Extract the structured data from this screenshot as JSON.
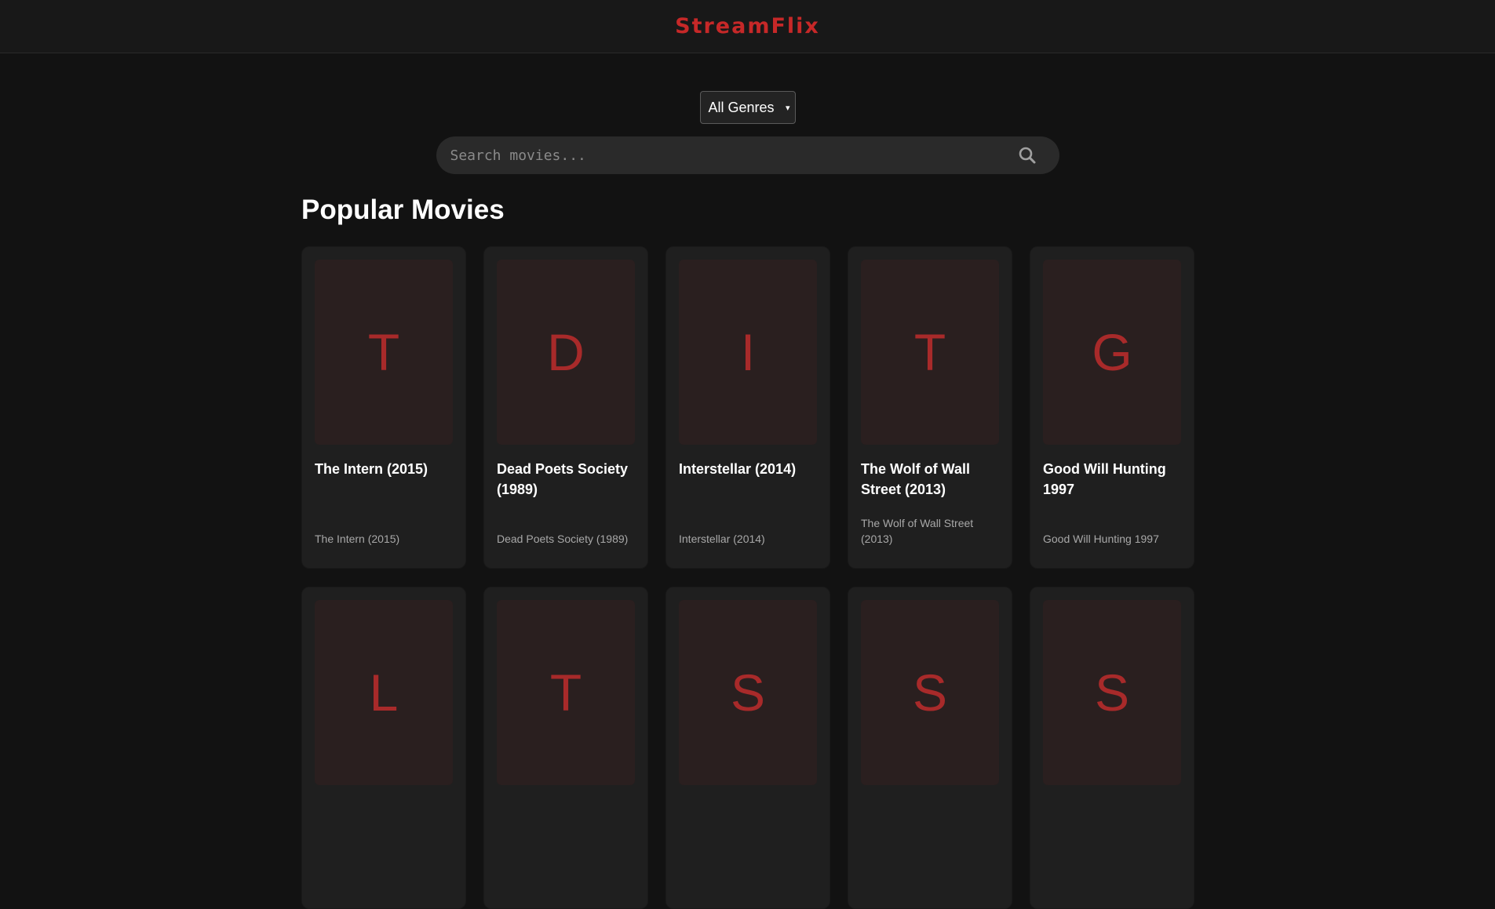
{
  "header": {
    "logo": "StreamFlix"
  },
  "filters": {
    "genre_selected": "All Genres"
  },
  "search": {
    "placeholder": "Search movies..."
  },
  "section": {
    "title": "Popular Movies"
  },
  "movies": [
    {
      "initial": "T",
      "title": "The Intern (2015)",
      "subtitle": "The Intern (2015)"
    },
    {
      "initial": "D",
      "title": "Dead Poets Society (1989)",
      "subtitle": "Dead Poets Society (1989)"
    },
    {
      "initial": "I",
      "title": "Interstellar (2014)",
      "subtitle": "Interstellar (2014)"
    },
    {
      "initial": "T",
      "title": "The Wolf of Wall Street (2013)",
      "subtitle": "The Wolf of Wall Street (2013)"
    },
    {
      "initial": "G",
      "title": "Good Will Hunting 1997",
      "subtitle": "Good Will Hunting 1997"
    },
    {
      "initial": "L",
      "title": "",
      "subtitle": ""
    },
    {
      "initial": "T",
      "title": "",
      "subtitle": ""
    },
    {
      "initial": "S",
      "title": "",
      "subtitle": ""
    },
    {
      "initial": "S",
      "title": "",
      "subtitle": ""
    },
    {
      "initial": "S",
      "title": "",
      "subtitle": ""
    }
  ],
  "colors": {
    "accent": "#c62828",
    "background": "#121212",
    "card": "#1f1f1f",
    "poster": "#2a1f1f"
  },
  "icons": {
    "search": "search-icon",
    "select": "chevron-down-icon"
  }
}
